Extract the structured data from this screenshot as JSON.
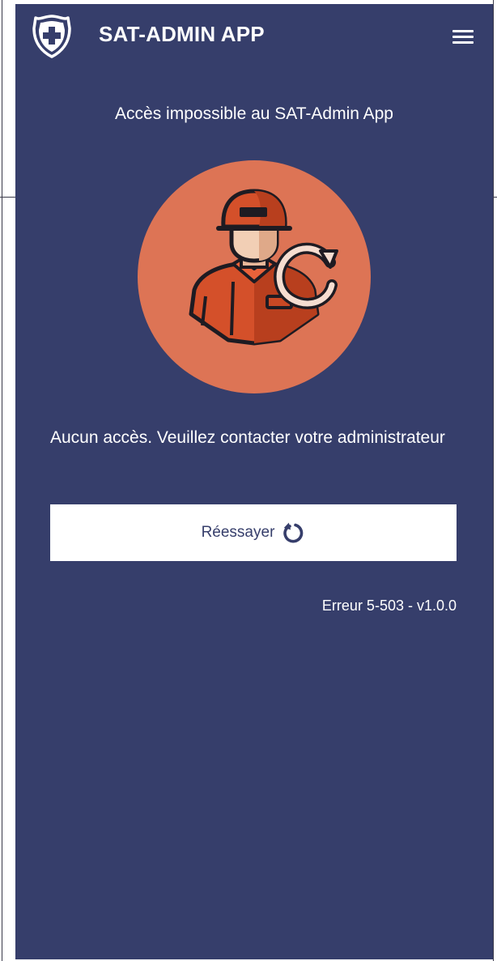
{
  "header": {
    "title": "SAT-ADMIN APP",
    "logo_icon": "swiss-shield-icon",
    "menu_icon": "hamburger-menu-icon"
  },
  "main": {
    "subtitle": "Accès impossible au SAT-Admin App",
    "illustration_icon": "soldier-refresh-icon",
    "message": "Aucun accès. Veuillez contacter votre administrateur",
    "retry_label": "Réessayer",
    "retry_icon": "refresh-icon",
    "error_code": "Erreur 5-503 - v1.0.0"
  },
  "colors": {
    "background": "#363e6b",
    "accent_circle": "#dd7455",
    "button_background": "#ffffff",
    "text": "#ffffff"
  }
}
